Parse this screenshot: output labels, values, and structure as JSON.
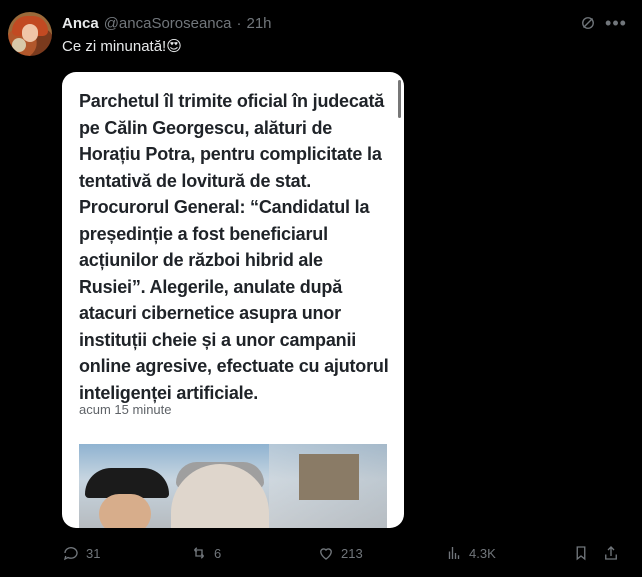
{
  "tweet": {
    "name": "Anca",
    "handle": "@ancaSoroseanca",
    "dot": "·",
    "time": "21h",
    "text": "Ce zi minunată!😍",
    "actions": {
      "replies": "31",
      "retweets": "6",
      "likes": "213",
      "views": "4.3K"
    }
  },
  "card": {
    "headline": "Parchetul îl trimite oficial în judecată pe Călin Georgescu, alături de Horațiu Potra, pentru complicitate la tentativă de lovitură de stat. Procurorul General: “Candidatul la președinție a fost beneficiarul acțiunilor de război hibrid ale Rusiei”. Alegerile, anulate după atacuri cibernetice asupra unor instituții cheie și a unor campanii online agresive, efectuate cu ajutorul inteligenței artificiale.",
    "meta": "acum 15 minute"
  },
  "icons": {
    "grok": "grok-icon",
    "more": "more-icon",
    "reply": "reply-icon",
    "retweet": "retweet-icon",
    "like": "heart-icon",
    "views": "views-icon",
    "bookmark": "bookmark-icon",
    "share": "share-icon"
  },
  "colors": {
    "background": "#000000",
    "text": "#e7e9ea",
    "muted": "#71767b",
    "card": "#ffffff"
  }
}
